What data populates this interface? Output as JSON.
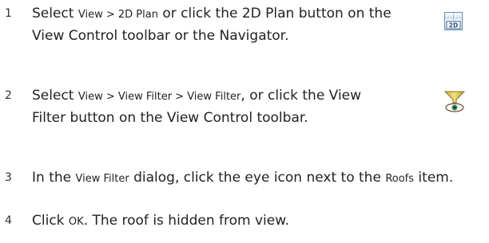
{
  "steps": [
    {
      "number": "1",
      "parts": [
        {
          "text": "Select ",
          "ui": false
        },
        {
          "text": "View > 2D Plan",
          "ui": true
        },
        {
          "text": " or click the 2D Plan button on the View Control toolbar or the Navigator.",
          "ui": false
        }
      ],
      "icon": {
        "name": "2d-plan-icon",
        "label": "2D"
      }
    },
    {
      "number": "2",
      "parts": [
        {
          "text": "Select ",
          "ui": false
        },
        {
          "text": "View > View Filter > View Filter",
          "ui": true
        },
        {
          "text": ", or click the View Filter button on the View Control toolbar.",
          "ui": false
        }
      ],
      "icon": {
        "name": "view-filter-icon"
      }
    },
    {
      "number": "3",
      "parts": [
        {
          "text": "In the ",
          "ui": false
        },
        {
          "text": "View Filter",
          "ui": true
        },
        {
          "text": " dialog, click the eye icon next to the ",
          "ui": false
        },
        {
          "text": "Roofs",
          "ui": true
        },
        {
          "text": " item.",
          "ui": false
        }
      ]
    },
    {
      "number": "4",
      "parts": [
        {
          "text": "Click ",
          "ui": false
        },
        {
          "text": "OK",
          "ui": true
        },
        {
          "text": ". The roof is hidden from view.",
          "ui": false
        }
      ]
    }
  ]
}
